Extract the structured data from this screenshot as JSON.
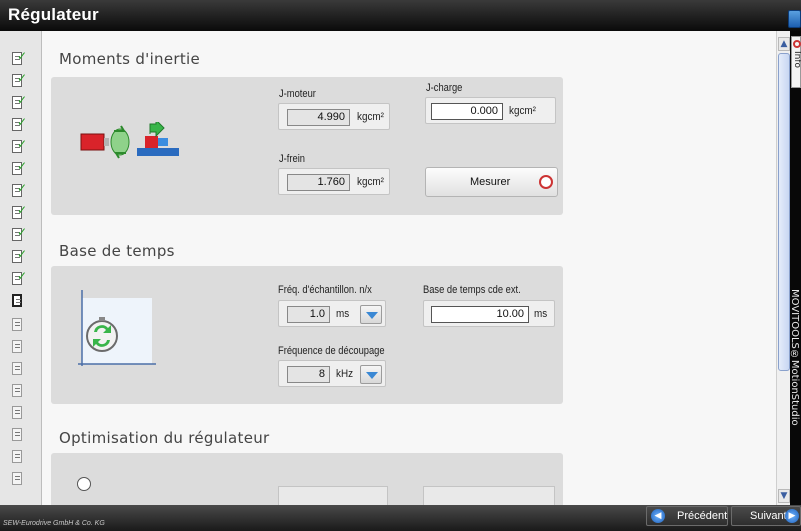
{
  "window": {
    "title": "Régulateur"
  },
  "sections": {
    "inertia": {
      "title": "Moments d'inertie",
      "j_moteur": {
        "label": "J-moteur",
        "value": "4.990",
        "unit": "kgcm²"
      },
      "j_charge": {
        "label": "J-charge",
        "value": "0.000",
        "unit": "kgcm²"
      },
      "j_frein": {
        "label": "J-frein",
        "value": "1.760",
        "unit": "kgcm²"
      },
      "measure_button": "Mesurer"
    },
    "timebase": {
      "title": "Base de temps",
      "sampling": {
        "label": "Fréq. d'échantillon. n/x",
        "value": "1.0",
        "unit": "ms"
      },
      "ext_timebase": {
        "label": "Base de temps cde ext.",
        "value": "10.00",
        "unit": "ms"
      },
      "pwm": {
        "label": "Fréquence de découpage",
        "value": "8",
        "unit": "kHz"
      }
    },
    "optimization": {
      "title": "Optimisation du régulateur"
    }
  },
  "side_tab": {
    "label": "Info"
  },
  "right_strip_text": "MOVITOOLS®MotionStudio",
  "footer": {
    "copyright": "SEW-Eurodrive GmbH & Co. KG",
    "prev_button": "Précédent",
    "next_button": "Suivant"
  },
  "steps": {
    "completed_count": 11,
    "pending_count": 8
  },
  "colors": {
    "check": "#2aa12a",
    "accent": "#3a88d4",
    "motor": "#d9232a",
    "arrow": "#39b54a"
  },
  "icons": [
    "motor-load-icon",
    "stopwatch-chart-icon",
    "dropdown-arrow-icon",
    "measure-icon",
    "previous-icon",
    "next-icon",
    "info-icon"
  ]
}
